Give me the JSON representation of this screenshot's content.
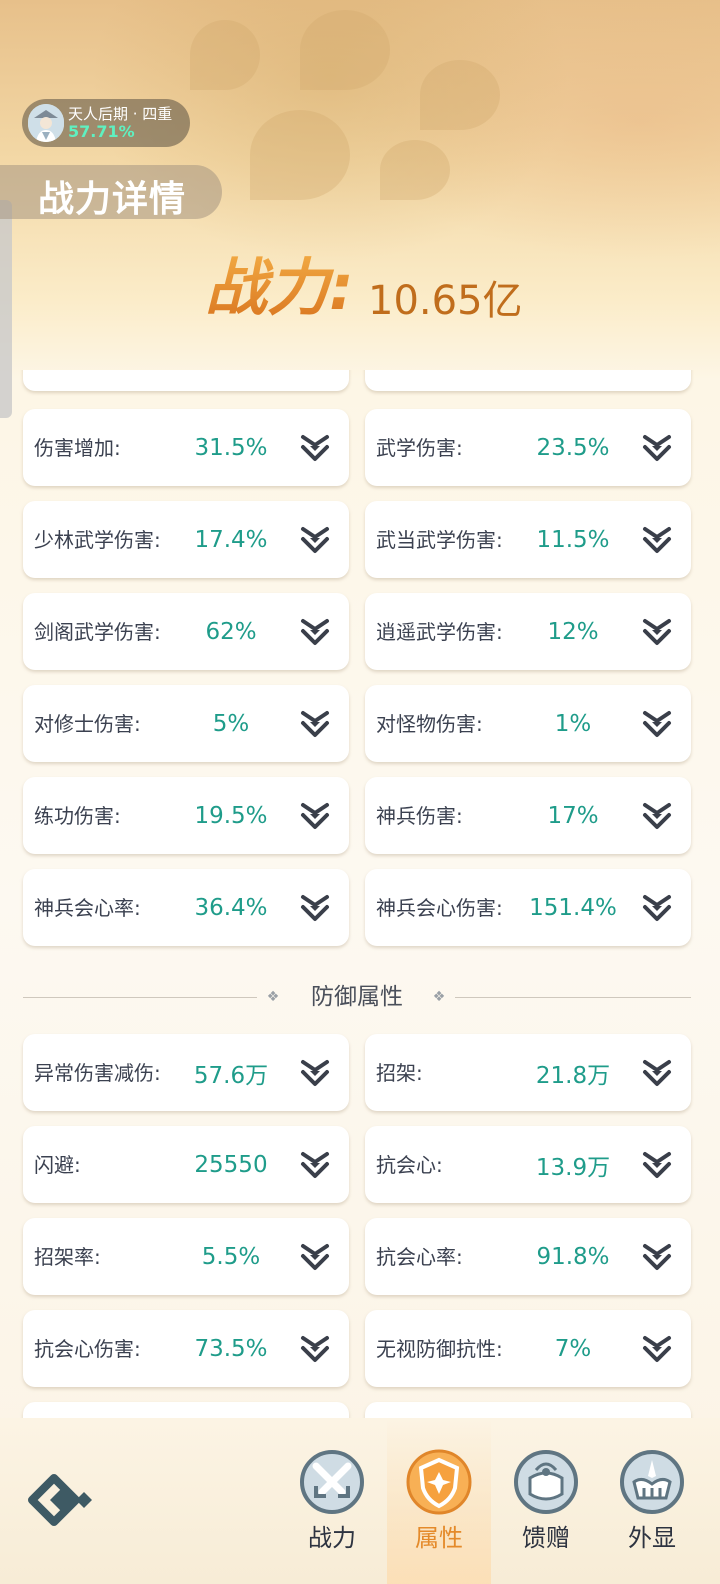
{
  "header": {
    "realm_name": "天人后期 · 四重",
    "realm_progress": "57.71%",
    "page_title": "战力详情",
    "power_label": "战力:",
    "power_value": "10.65亿"
  },
  "attack_stats": [
    {
      "label": "伤害增加:",
      "value": "31.5%"
    },
    {
      "label": "武学伤害:",
      "value": "23.5%"
    },
    {
      "label": "少林武学伤害:",
      "value": "17.4%"
    },
    {
      "label": "武当武学伤害:",
      "value": "11.5%"
    },
    {
      "label": "剑阁武学伤害:",
      "value": "62%"
    },
    {
      "label": "逍遥武学伤害:",
      "value": "12%"
    },
    {
      "label": "对修士伤害:",
      "value": "5%"
    },
    {
      "label": "对怪物伤害:",
      "value": "1%"
    },
    {
      "label": "练功伤害:",
      "value": "19.5%"
    },
    {
      "label": "神兵伤害:",
      "value": "17%"
    },
    {
      "label": "神兵会心率:",
      "value": "36.4%"
    },
    {
      "label": "神兵会心伤害:",
      "value": "151.4%"
    }
  ],
  "defense_section_title": "防御属性",
  "defense_stats": [
    {
      "label": "异常伤害减伤:",
      "value": "57.6万"
    },
    {
      "label": "招架:",
      "value": "21.8万"
    },
    {
      "label": "闪避:",
      "value": "25550"
    },
    {
      "label": "抗会心:",
      "value": "13.9万"
    },
    {
      "label": "招架率:",
      "value": "5.5%"
    },
    {
      "label": "抗会心率:",
      "value": "91.8%"
    },
    {
      "label": "抗会心伤害:",
      "value": "73.5%"
    },
    {
      "label": "无视防御抗性:",
      "value": "7%"
    }
  ],
  "bottom_nav": [
    {
      "label": "战力",
      "icon": "swords-icon",
      "active": false
    },
    {
      "label": "属性",
      "icon": "shield-icon",
      "active": true
    },
    {
      "label": "馈赠",
      "icon": "gift-bag-icon",
      "active": false
    },
    {
      "label": "外显",
      "icon": "appearance-icon",
      "active": false
    }
  ],
  "colors": {
    "value_text": "#1f9c8a",
    "power_orange": "#e8902a",
    "active_nav": "#e48a2a"
  }
}
